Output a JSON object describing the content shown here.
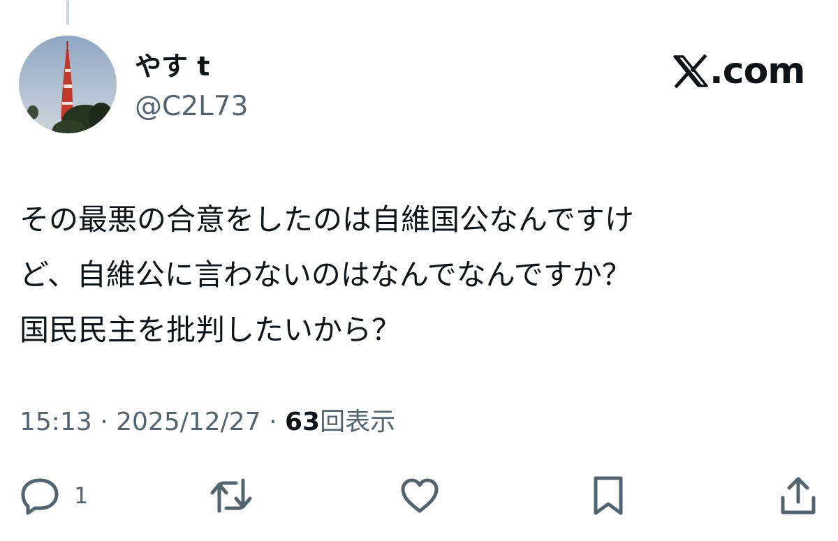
{
  "author": {
    "display_name": "やす t",
    "handle": "@C2L73",
    "avatar_icon": "tokyo-tower-photo"
  },
  "brand": {
    "label": ".com",
    "logo_icon": "x-logo-icon"
  },
  "tweet": {
    "lines": [
      "その最悪の合意をしたのは自維国公なんですけ",
      "ど、自維公に言わないのはなんでなんですか？",
      "国民民主を批判したいから？"
    ]
  },
  "meta": {
    "time": "15:13",
    "separator": "·",
    "date": "2025/12/27",
    "views_count": "63",
    "views_label": "回表示"
  },
  "actions": {
    "reply_count": "1"
  },
  "colors": {
    "text": "#0f1419",
    "muted": "#536471",
    "thread_line": "#cfd9de"
  }
}
